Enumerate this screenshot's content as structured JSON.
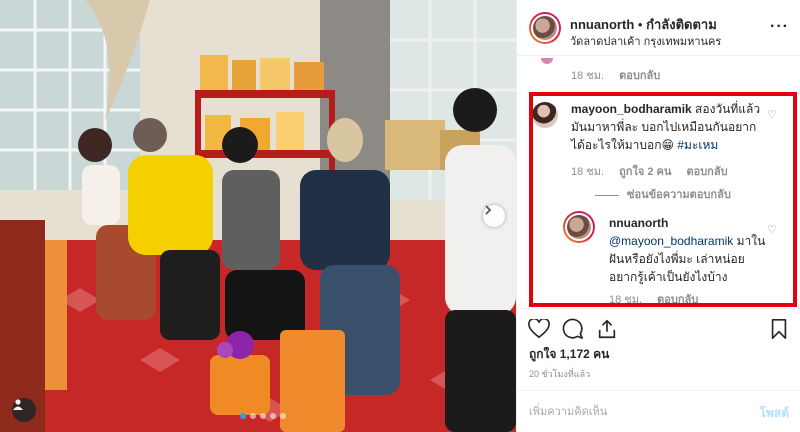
{
  "post": {
    "photo_alt": "",
    "carousel_dots": 5,
    "carousel_active": 0
  },
  "header": {
    "username": "nnuanorth",
    "separator": "•",
    "follow_label": "กำลังติดตาม",
    "location": "วัดลาดปลาเค้า กรุงเทพมหานคร",
    "more_icon": "ellipsis-icon"
  },
  "previous_comment": {
    "time": "18 ชม.",
    "reply_label": "ตอบกลับ"
  },
  "comments": [
    {
      "username": "mayoon_bodharamik",
      "text": "สองวันที่แล้วมันมาหาพี่ละ บอกไปเหมือนกันอยากได้อะไรให้มาบอก😁",
      "hashtag": "#มะเหม",
      "time": "18 ชม.",
      "likes_label": "ถูกใจ 2 คน",
      "reply_label": "ตอบกลับ",
      "hide_replies_label": "ซ่อนข้อความตอบกลับ"
    },
    {
      "username": "nnuanorth",
      "mention": "@mayoon_bodharamik",
      "text": " มาในฝันหรือยังไงพี่มะ เล่าหน่อยอยากรู้เค้าเป็นยังไงบ้าง",
      "time": "18 ชม.",
      "reply_label": "ตอบกลับ"
    }
  ],
  "actions": {
    "like_icon": "heart-icon",
    "comment_icon": "comment-icon",
    "share_icon": "share-icon",
    "save_icon": "bookmark-icon"
  },
  "likes_text": "ถูกใจ 1,172 คน",
  "time_ago": "20 ชั่วโมงที่แล้ว",
  "add_comment": {
    "placeholder": "เพิ่มความคิดเห็น",
    "post_label": "โพสต์"
  },
  "colors": {
    "highlight": "#e3000f",
    "link": "#003569",
    "post_button": "#b2dffc",
    "active_dot": "#3897f0"
  }
}
